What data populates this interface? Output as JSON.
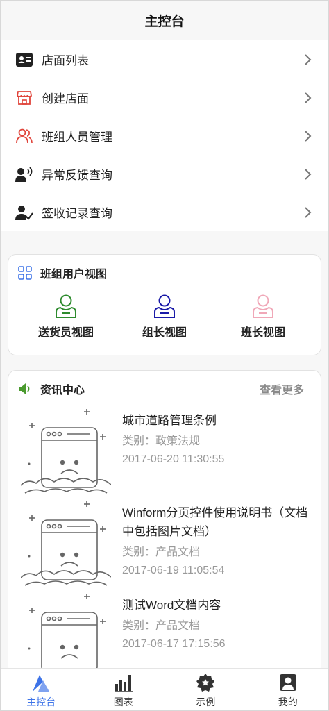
{
  "header": {
    "title": "主控台"
  },
  "menu": {
    "items": [
      {
        "label": "店面列表",
        "icon": "id-card-icon"
      },
      {
        "label": "创建店面",
        "icon": "store-icon"
      },
      {
        "label": "班组人员管理",
        "icon": "users-icon"
      },
      {
        "label": "异常反馈查询",
        "icon": "speaking-person-icon"
      },
      {
        "label": "签收记录查询",
        "icon": "user-check-icon"
      }
    ]
  },
  "team_view": {
    "title": "班组用户视图",
    "views": [
      {
        "label": "送货员视图",
        "color": "#2e8b2e"
      },
      {
        "label": "组长视图",
        "color": "#1a1aa8"
      },
      {
        "label": "班长视图",
        "color": "#f0a8b8"
      }
    ]
  },
  "news": {
    "title": "资讯中心",
    "more": "查看更多",
    "items": [
      {
        "title": "城市道路管理条例",
        "category": "类别：政策法规",
        "time": "2017-06-20 11:30:55"
      },
      {
        "title": "Winform分页控件使用说明书（文档中包括图片文档）",
        "category": "类别：产品文档",
        "time": "2017-06-19 11:05:54"
      },
      {
        "title": "测试Word文档内容",
        "category": "类别：产品文档",
        "time": "2017-06-17 17:15:56"
      }
    ]
  },
  "tabbar": {
    "tabs": [
      {
        "label": "主控台",
        "active": true
      },
      {
        "label": "图表",
        "active": false
      },
      {
        "label": "示例",
        "active": false
      },
      {
        "label": "我的",
        "active": false
      }
    ]
  },
  "colors": {
    "accent": "#3d73e8",
    "store_red": "#e0443a",
    "news_green": "#4a9a2e"
  }
}
